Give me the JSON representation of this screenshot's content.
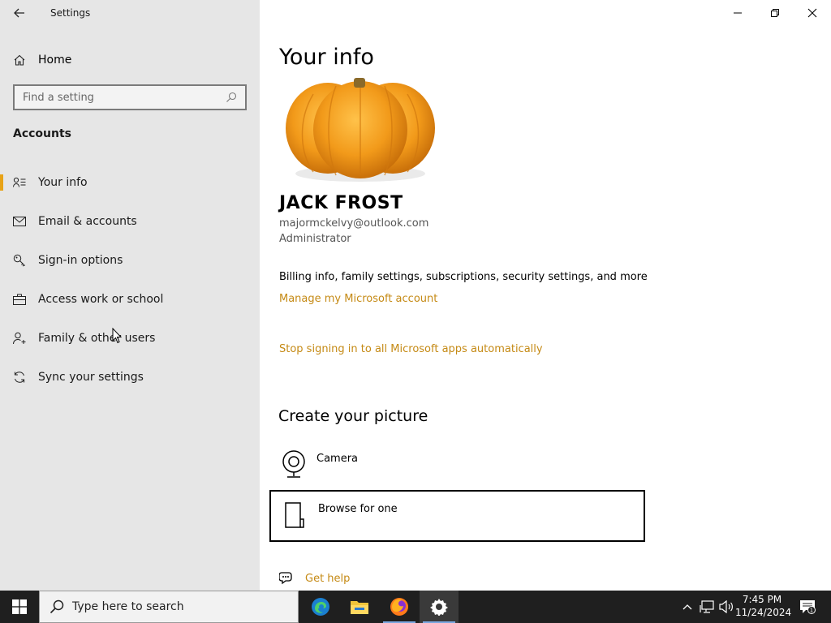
{
  "window": {
    "title": "Settings"
  },
  "nav": {
    "home_label": "Home",
    "search_placeholder": "Find a setting",
    "section_title": "Accounts",
    "items": [
      {
        "label": "Your info",
        "icon": "person-card-icon",
        "selected": true
      },
      {
        "label": "Email & accounts",
        "icon": "email-icon",
        "selected": false
      },
      {
        "label": "Sign-in options",
        "icon": "key-icon",
        "selected": false
      },
      {
        "label": "Access work or school",
        "icon": "briefcase-icon",
        "selected": false
      },
      {
        "label": "Family & other users",
        "icon": "person-add-icon",
        "selected": false
      },
      {
        "label": "Sync your settings",
        "icon": "sync-icon",
        "selected": false
      }
    ]
  },
  "content": {
    "page_title": "Your info",
    "user_name": "JACK FROST",
    "user_email": "majormckelvy@outlook.com",
    "user_role": "Administrator",
    "billing_text": "Billing info, family settings, subscriptions, security settings, and more",
    "manage_link": "Manage my Microsoft account",
    "stop_signing_link": "Stop signing in to all Microsoft apps automatically",
    "create_picture_title": "Create your picture",
    "camera_label": "Camera",
    "browse_label": "Browse for one",
    "get_help_label": "Get help"
  },
  "taskbar": {
    "search_placeholder": "Type here to search",
    "time": "7:45 PM",
    "date": "11/24/2024",
    "notification_count": "1"
  },
  "colors": {
    "accent": "#e8a317",
    "link": "#c58a15",
    "nav_bg": "#e6e6e6",
    "taskbar_bg": "#1f1f1f"
  }
}
